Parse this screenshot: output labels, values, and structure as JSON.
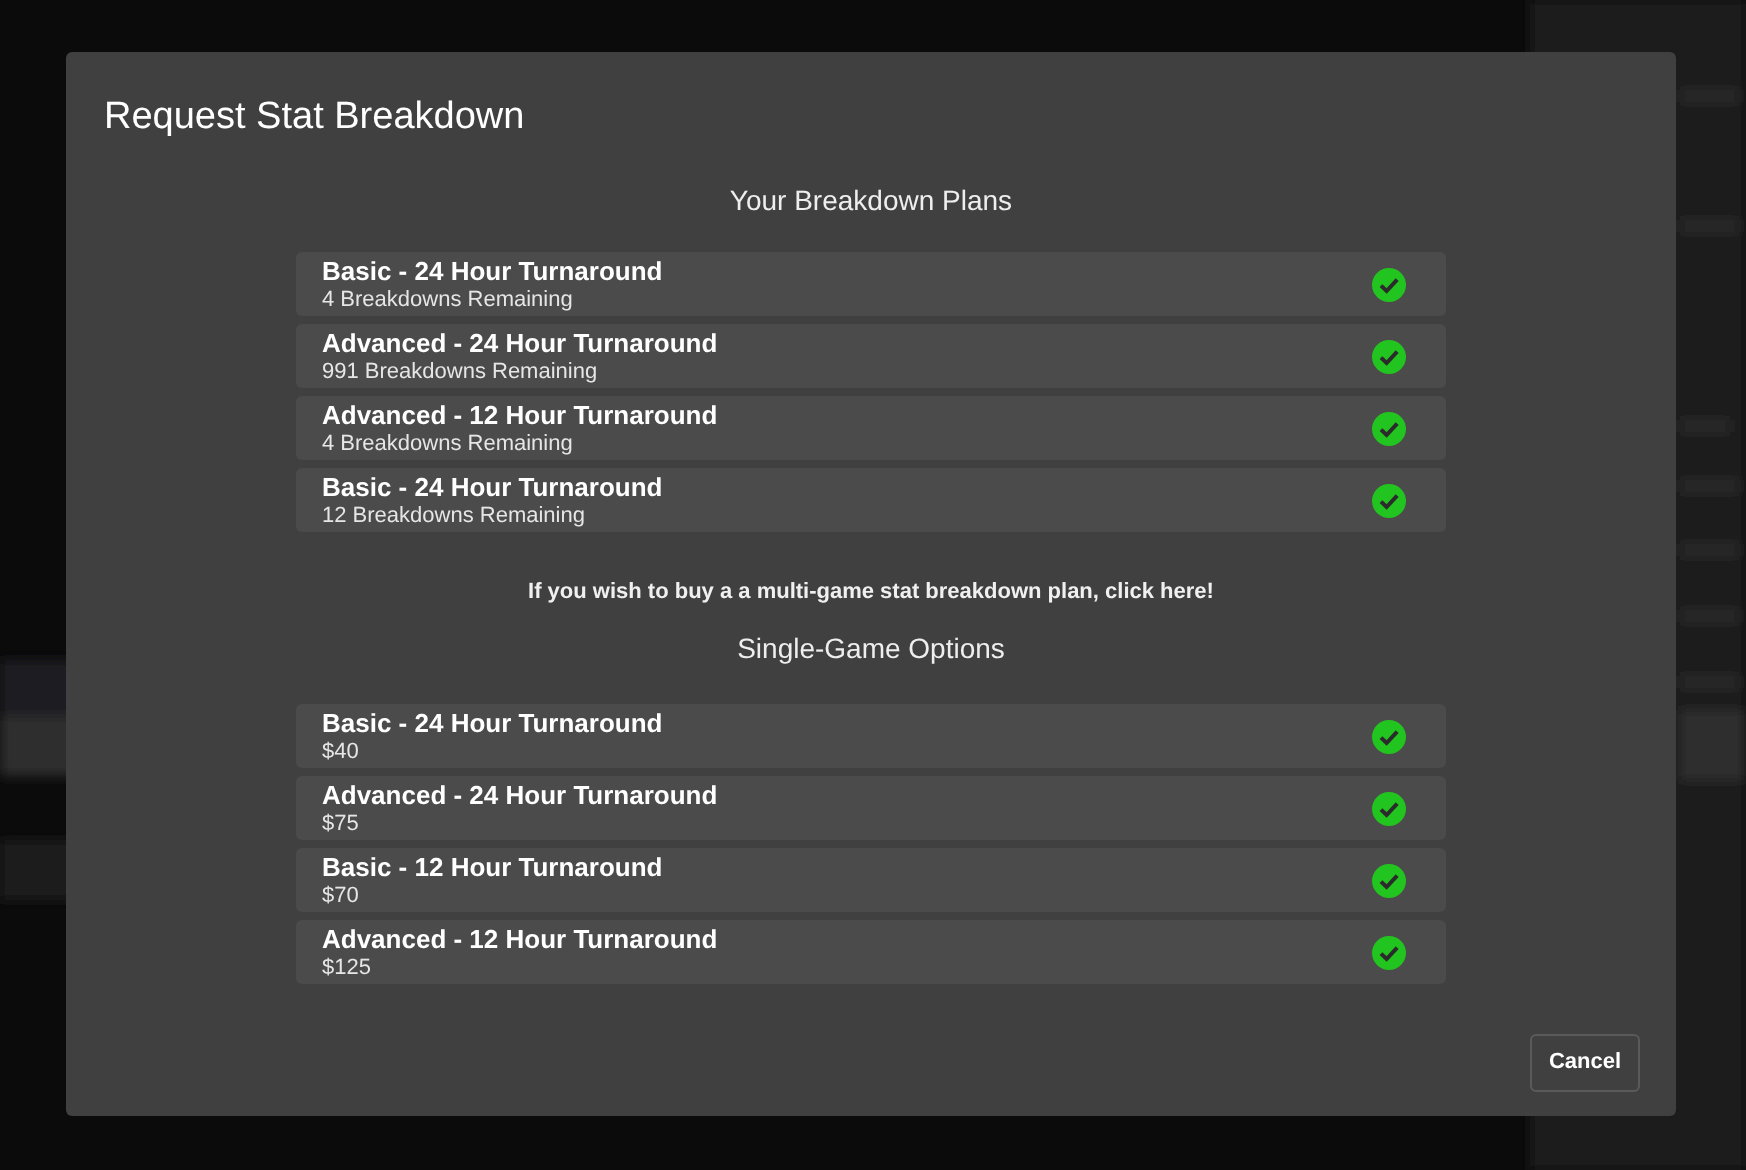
{
  "dialog": {
    "title": "Request Stat Breakdown",
    "sections": [
      {
        "heading": "Your Breakdown Plans",
        "options": [
          {
            "name": "Basic - 24 Hour Turnaround",
            "detail": "4 Breakdowns Remaining",
            "available": true
          },
          {
            "name": "Advanced - 24 Hour Turnaround",
            "detail": "991 Breakdowns Remaining",
            "available": true
          },
          {
            "name": "Advanced - 12 Hour Turnaround",
            "detail": "4 Breakdowns Remaining",
            "available": true
          },
          {
            "name": "Basic - 24 Hour Turnaround",
            "detail": "12 Breakdowns Remaining",
            "available": true
          }
        ],
        "note": "If you wish to buy a a multi-game stat breakdown plan, click here!"
      },
      {
        "heading": "Single-Game Options",
        "options": [
          {
            "name": "Basic - 24 Hour Turnaround",
            "detail": "$40",
            "available": true
          },
          {
            "name": "Advanced - 24 Hour Turnaround",
            "detail": "$75",
            "available": true
          },
          {
            "name": "Basic - 12 Hour Turnaround",
            "detail": "$70",
            "available": true
          },
          {
            "name": "Advanced - 12 Hour Turnaround",
            "detail": "$125",
            "available": true
          }
        ]
      }
    ],
    "buttons": [
      "Cancel"
    ]
  }
}
